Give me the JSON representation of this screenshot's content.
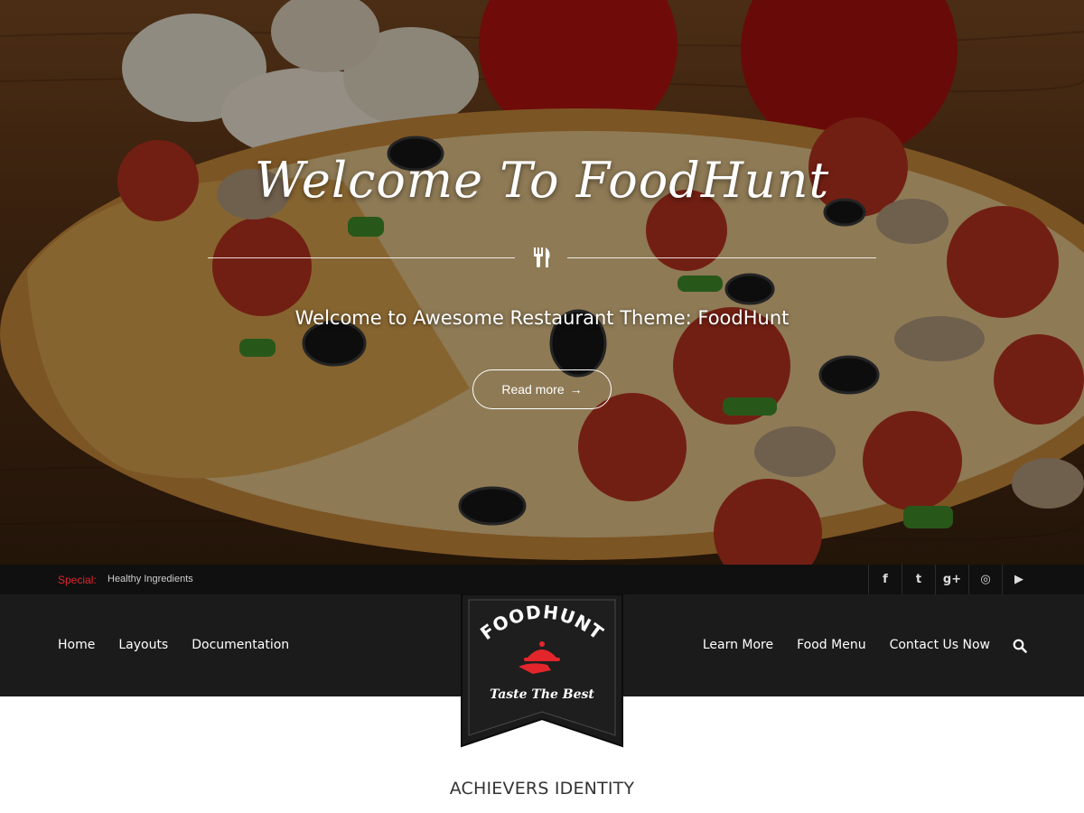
{
  "hero": {
    "title": "Welcome To FoodHunt",
    "subtitle": "Welcome to Awesome Restaurant Theme: FoodHunt",
    "button_label": "Read more",
    "button_arrow": "→"
  },
  "topbar": {
    "special_label": "Special:",
    "special_text": "Healthy Ingredients",
    "socials": [
      {
        "name": "facebook-icon",
        "glyph": "f"
      },
      {
        "name": "twitter-icon",
        "glyph": "t"
      },
      {
        "name": "google-plus-icon",
        "glyph": "g+"
      },
      {
        "name": "instagram-icon",
        "glyph": "◎"
      },
      {
        "name": "youtube-icon",
        "glyph": "▶"
      }
    ]
  },
  "nav": {
    "left": [
      "Home",
      "Layouts",
      "Documentation"
    ],
    "right": [
      "Learn More",
      "Food Menu",
      "Contact Us Now"
    ]
  },
  "logo": {
    "name": "FOODHUNT",
    "tagline": "Taste The Best"
  },
  "section": {
    "heading": "ACHIEVERS IDENTITY"
  },
  "colors": {
    "accent_red": "#e3262b",
    "nav_bg": "#1b1b1b",
    "topbar_bg": "#101010"
  }
}
